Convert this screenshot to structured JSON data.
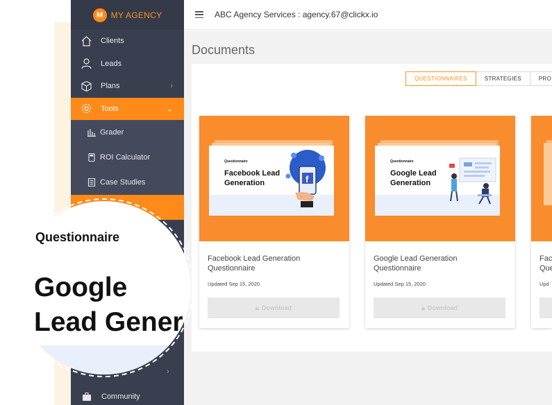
{
  "brand": {
    "logo_letter": "M",
    "name_prefix": "MY",
    "name_suffix": "AGENCY"
  },
  "sidebar": {
    "items": [
      {
        "label": "Clients",
        "icon": "home-icon"
      },
      {
        "label": "Leads",
        "icon": "user-icon"
      },
      {
        "label": "Plans",
        "icon": "box-icon"
      },
      {
        "label": "Tools",
        "icon": "gear-icon"
      }
    ],
    "sub_items": [
      {
        "label": "Grader",
        "icon": "bar-chart-icon"
      },
      {
        "label": "ROI Calculator",
        "icon": "calculator-icon"
      },
      {
        "label": "Case Studies",
        "icon": "document-icon"
      }
    ],
    "community_label": "Community"
  },
  "topbar": {
    "title": "ABC Agency Services : agency.67@clickx.io"
  },
  "page": {
    "title": "Documents"
  },
  "tabs": [
    {
      "label": "QUESTIONNAIRES",
      "active": true
    },
    {
      "label": "STRATEGIES",
      "active": false
    },
    {
      "label": "PRO",
      "active": false
    }
  ],
  "cards": [
    {
      "thumb_kicker": "Questionnaire",
      "thumb_title": "Facebook Lead Generation",
      "title": "Facebook Lead Generation Questionnaire",
      "updated": "Updated Sep 15, 2020",
      "download_label": "Download"
    },
    {
      "thumb_kicker": "Questionnaire",
      "thumb_title": "Google Lead Generation",
      "title": "Google Lead Generation Questionnaire",
      "updated": "Updated Sep 15, 2020",
      "download_label": "Download"
    },
    {
      "title": "Fac Que",
      "updated": "Upd",
      "download_label": ""
    }
  ],
  "zoom": {
    "kicker": "Questionnaire",
    "title_line1": "Google",
    "title_line2": "Lead Gener"
  },
  "colors": {
    "accent": "#fe8a1a",
    "sidebar": "#3a3f4f",
    "thumb_bg": "#f98c2c",
    "light_blue": "#e9f0fb"
  }
}
